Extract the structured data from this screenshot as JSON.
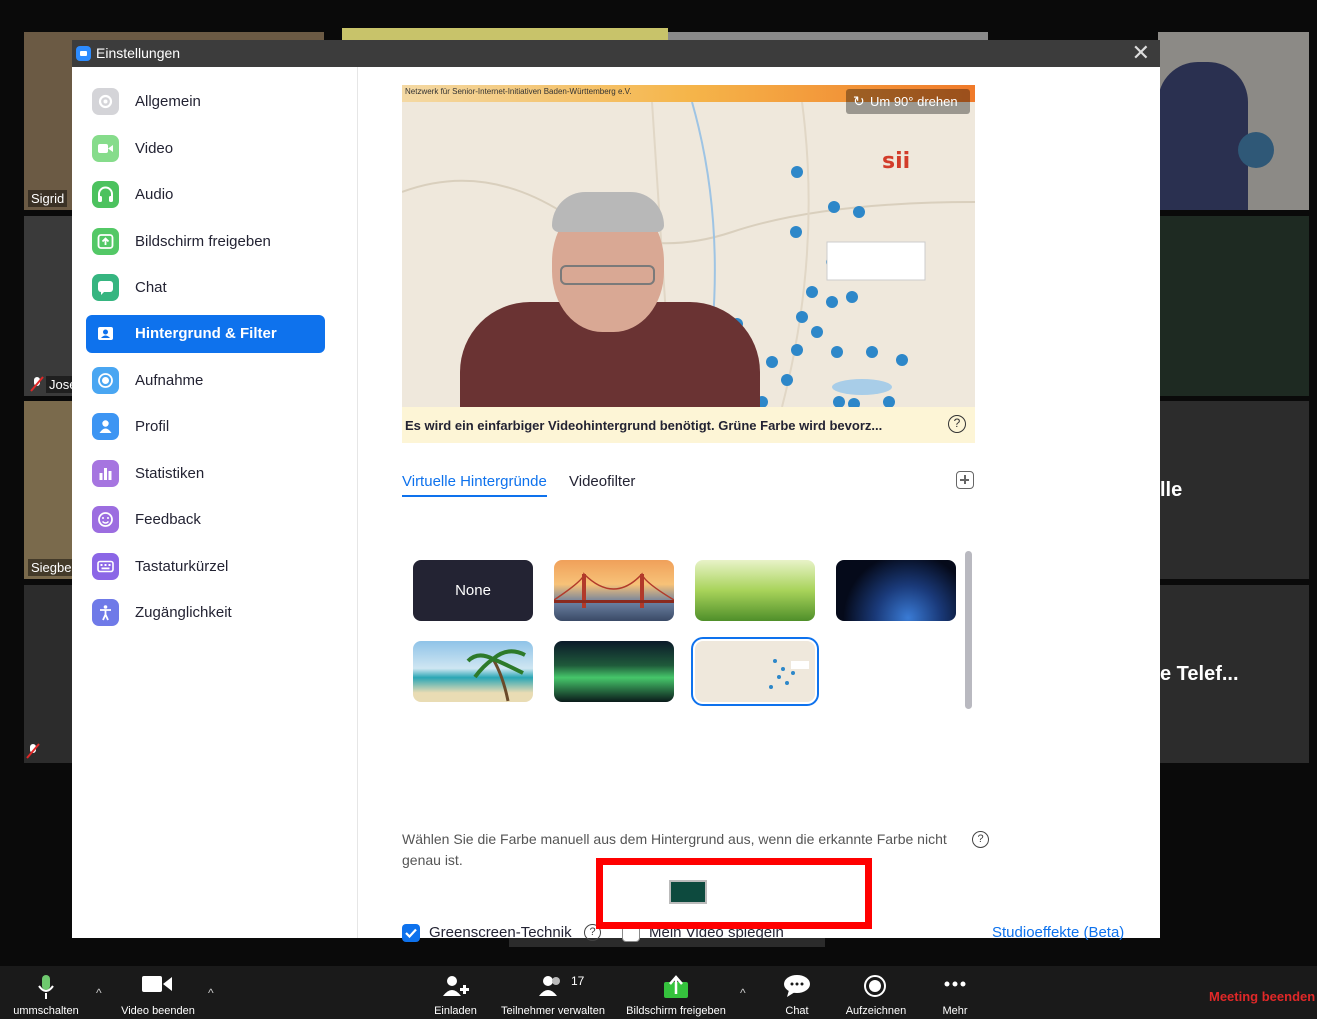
{
  "gallery": {
    "names": [
      "Sigrid",
      "Jose",
      "Siegbe"
    ],
    "overlay_text": [
      "lle",
      "e Telef..."
    ]
  },
  "dialog": {
    "title": "Einstellungen",
    "close_symbol": "✕"
  },
  "sidebar": {
    "items": [
      {
        "label": "Allgemein",
        "icon": "gear-icon",
        "color": "#c8c8cc"
      },
      {
        "label": "Video",
        "icon": "video-camera-icon",
        "color": "#86dc8b"
      },
      {
        "label": "Audio",
        "icon": "headphones-icon",
        "color": "#4cc25e"
      },
      {
        "label": "Bildschirm freigeben",
        "icon": "share-screen-icon",
        "color": "#53c866"
      },
      {
        "label": "Chat",
        "icon": "chat-bubble-icon",
        "color": "#36b580"
      },
      {
        "label": "Hintergrund & Filter",
        "icon": "background-person-icon",
        "color": "#0e72ed"
      },
      {
        "label": "Aufnahme",
        "icon": "record-icon",
        "color": "#49a6f2"
      },
      {
        "label": "Profil",
        "icon": "profile-icon",
        "color": "#3d95f3"
      },
      {
        "label": "Statistiken",
        "icon": "statistics-icon",
        "color": "#a675e0"
      },
      {
        "label": "Feedback",
        "icon": "feedback-smiley-icon",
        "color": "#9c6de0"
      },
      {
        "label": "Tastaturkürzel",
        "icon": "keyboard-icon",
        "color": "#8b66e6"
      },
      {
        "label": "Zugänglichkeit",
        "icon": "accessibility-icon",
        "color": "#6f7ae8"
      }
    ],
    "active_index": 5
  },
  "preview": {
    "map_header": "Netzwerk für Senior-Internet-Initiativen Baden-Württemberg e.V.",
    "rotate_label": "Um 90° drehen",
    "caption": "Es wird ein einfarbiger Videohintergrund benötigt. Grüne Farbe wird bevorz...",
    "help_symbol": "?"
  },
  "tabs": [
    {
      "label": "Virtuelle Hintergründe",
      "active": true
    },
    {
      "label": "Videofilter",
      "active": false
    }
  ],
  "backgrounds": [
    {
      "label": "None",
      "kind": "none"
    },
    {
      "label": "",
      "kind": "golden-gate"
    },
    {
      "label": "",
      "kind": "grass"
    },
    {
      "label": "",
      "kind": "earth"
    },
    {
      "label": "",
      "kind": "beach"
    },
    {
      "label": "",
      "kind": "aurora"
    },
    {
      "label": "",
      "kind": "map",
      "selected": true
    }
  ],
  "hint_text": "Wählen Sie die Farbe manuell aus dem Hintergrund aus, wenn die erkannte Farbe nicht genau ist.",
  "picked_color": "#0d4a3e",
  "options": {
    "greenscreen_label": "Greenscreen-Technik",
    "greenscreen_checked": true,
    "mirror_label": "Mein Video spiegeln",
    "mirror_checked": false,
    "studio_link": "Studioeffekte (Beta)"
  },
  "toolbar": {
    "unmute_label": "ummschalten",
    "video_label": "Video beenden",
    "invite_label": "Einladen",
    "participants_label": "Teilnehmer verwalten",
    "participants_count": "17",
    "share_label": "Bildschirm freigeben",
    "chat_label": "Chat",
    "record_label": "Aufzeichnen",
    "more_label": "Mehr",
    "end_label": "Meeting beenden"
  }
}
